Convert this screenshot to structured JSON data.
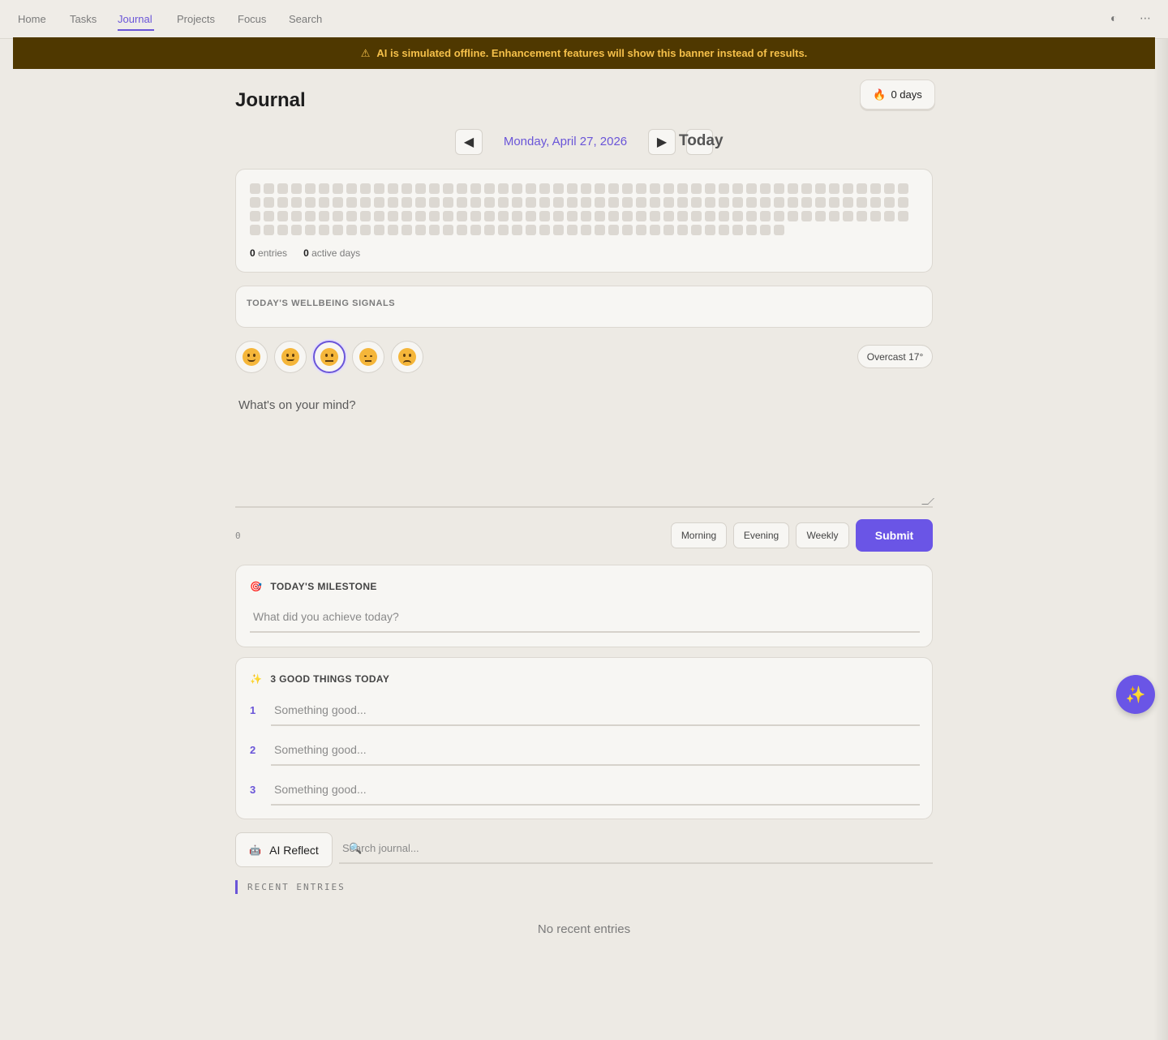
{
  "nav": {
    "items": [
      {
        "label": "Home",
        "active": false
      },
      {
        "label": "Tasks",
        "active": false
      },
      {
        "label": "Journal",
        "active": true
      },
      {
        "label": "Projects",
        "active": false
      },
      {
        "label": "Focus",
        "active": false
      },
      {
        "label": "Search",
        "active": false
      }
    ],
    "theme_icon": "◐",
    "more_icon": "⋯"
  },
  "banner": {
    "icon": "⚠",
    "text": "AI is simulated offline. Enhancement features will show this banner instead of results."
  },
  "journal": {
    "title": "Journal",
    "streak_icon": "🔥",
    "streak_text": "0 days",
    "prev_icon": "◀",
    "next_icon": "▶",
    "date": "Monday, April 27, 2026",
    "today_label": "Today"
  },
  "heatmap": {
    "entries_count": "0",
    "entries_label": "entries",
    "active_days_count": "0",
    "active_days_label": "active days"
  },
  "signals": {
    "label": "TODAY'S WELLBEING SIGNALS"
  },
  "moods": {
    "selected_index": 2,
    "options": [
      "great",
      "good",
      "okay",
      "low",
      "bad"
    ]
  },
  "weather": {
    "text": "Overcast 17°"
  },
  "editor": {
    "placeholder": "What's on your mind?",
    "char_count": "0"
  },
  "templates": {
    "morning": "Morning",
    "evening": "Evening",
    "weekly": "Weekly",
    "submit": "Submit"
  },
  "milestone": {
    "icon": "🎯",
    "title": "TODAY'S MILESTONE",
    "placeholder": "What did you achieve today?"
  },
  "good_things": {
    "icon": "✨",
    "title": "3 GOOD THINGS TODAY",
    "items": [
      {
        "num": "1",
        "placeholder": "Something good..."
      },
      {
        "num": "2",
        "placeholder": "Something good..."
      },
      {
        "num": "3",
        "placeholder": "Something good..."
      }
    ]
  },
  "reflect": {
    "icon": "🤖",
    "label": "AI Reflect",
    "search_placeholder": "Search journal...",
    "search_icon": "🔍"
  },
  "recent": {
    "label": "RECENT ENTRIES",
    "empty": "No recent entries"
  },
  "fab": {
    "icon": "✨"
  }
}
